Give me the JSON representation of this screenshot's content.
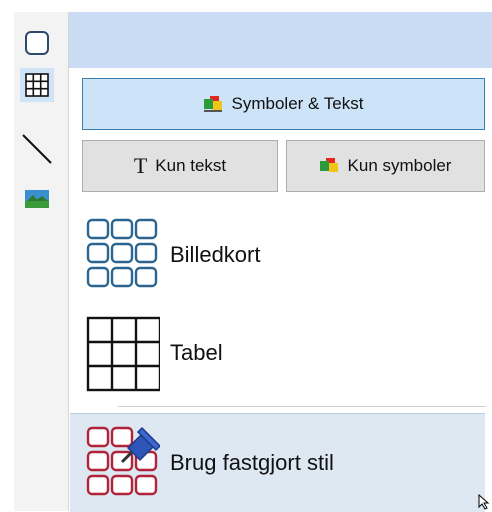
{
  "toolstrip": {
    "items": [
      {
        "name": "shape",
        "icon": "rounded-square-icon"
      },
      {
        "name": "table",
        "icon": "grid-icon",
        "selected": true
      },
      {
        "name": "line",
        "icon": "line-icon"
      },
      {
        "name": "image",
        "icon": "picture-icon"
      }
    ]
  },
  "buttons": {
    "symbols_text": "Symboler & Tekst",
    "text_only": "Kun tekst",
    "text_only_glyph": "T",
    "symbols_only": "Kun symboler"
  },
  "layouts": {
    "picture_cards": "Billedkort",
    "table": "Tabel",
    "pinned_style": "Brug fastgjort stil"
  },
  "colors": {
    "accent": "#3c7fb1",
    "selected_bg": "#cde4f8",
    "header_band": "#c9dcf3",
    "card_blue": "#2c6690",
    "card_red": "#b0243a",
    "pin_blue": "#2f55b8"
  }
}
